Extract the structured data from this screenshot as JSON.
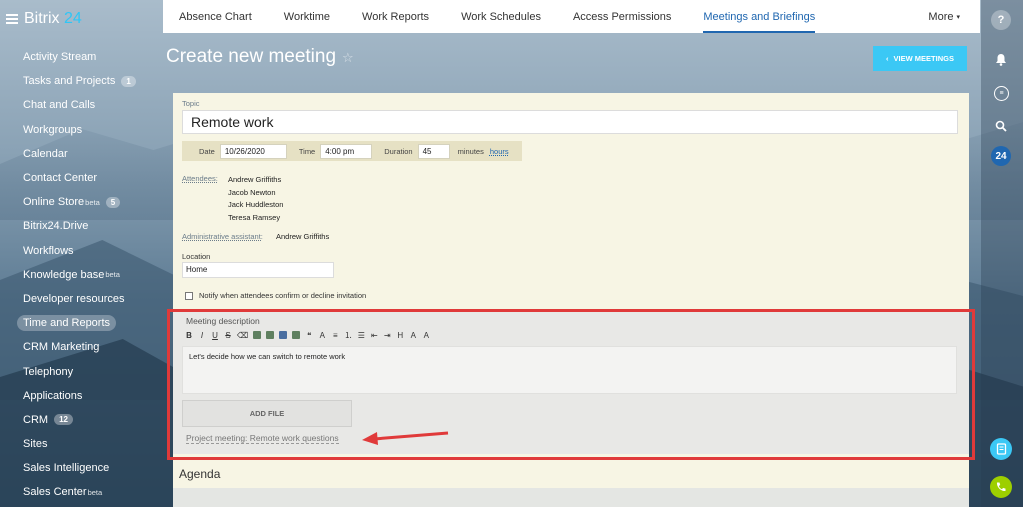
{
  "app": {
    "brand_name": "Bitrix",
    "brand_num": "24"
  },
  "sidebar": {
    "items": [
      {
        "label": "Activity Stream"
      },
      {
        "label": "Tasks and Projects",
        "badge": "1"
      },
      {
        "label": "Chat and Calls"
      },
      {
        "label": "Workgroups"
      },
      {
        "label": "Calendar"
      },
      {
        "label": "Contact Center"
      },
      {
        "label": "Online Store",
        "sup": "beta",
        "badge": "5"
      },
      {
        "label": "Bitrix24.Drive"
      },
      {
        "label": "Workflows"
      },
      {
        "label": "Knowledge base",
        "sup": "beta"
      },
      {
        "label": "Developer resources"
      },
      {
        "label": "Time and Reports",
        "active": true
      },
      {
        "label": "CRM Marketing"
      },
      {
        "label": "Telephony"
      },
      {
        "label": "Applications"
      },
      {
        "label": "CRM",
        "badge": "12"
      },
      {
        "label": "Sites"
      },
      {
        "label": "Sales Intelligence"
      },
      {
        "label": "Sales Center",
        "sup": "beta"
      }
    ]
  },
  "tabs": {
    "items": [
      "Absence Chart",
      "Worktime",
      "Work Reports",
      "Work Schedules",
      "Access Permissions",
      "Meetings and Briefings"
    ],
    "active": "Meetings and Briefings",
    "more": "More"
  },
  "rightbar": {
    "q": "?",
    "counter": "24"
  },
  "page": {
    "title": "Create new meeting",
    "star": "☆",
    "view_button": "VIEW MEETINGS"
  },
  "form": {
    "topic_label": "Topic",
    "topic_value": "Remote work",
    "date_label": "Date",
    "date_value": "10/26/2020",
    "time_label": "Time",
    "time_value": "4:00 pm",
    "duration_label": "Duration",
    "duration_value": "45",
    "minutes_label": "minutes",
    "hours_label": "hours",
    "attendees_label": "Attendees:",
    "attendees": [
      "Andrew Griffiths",
      "Jacob Newton",
      "Jack Huddleston",
      "Teresa Ramsey"
    ],
    "assistant_label": "Administrative assistant:",
    "assistant_value": "Andrew Griffiths",
    "location_label": "Location",
    "location_value": "Home",
    "notify_label": "Notify when attendees confirm or decline invitation",
    "notify_checked": false
  },
  "description": {
    "label": "Meeting description",
    "toolbar": [
      "B",
      "I",
      "U",
      "S"
    ],
    "text": "Let's decide how we can switch to remote work",
    "add_file": "ADD FILE",
    "project_link": "Project meeting: Remote work questions"
  },
  "agenda": {
    "title": "Agenda"
  },
  "colors": {
    "accent": "#2067b0",
    "button": "#3bc8f5",
    "highlight": "#e03a3a",
    "card": "#f7f5e4"
  }
}
